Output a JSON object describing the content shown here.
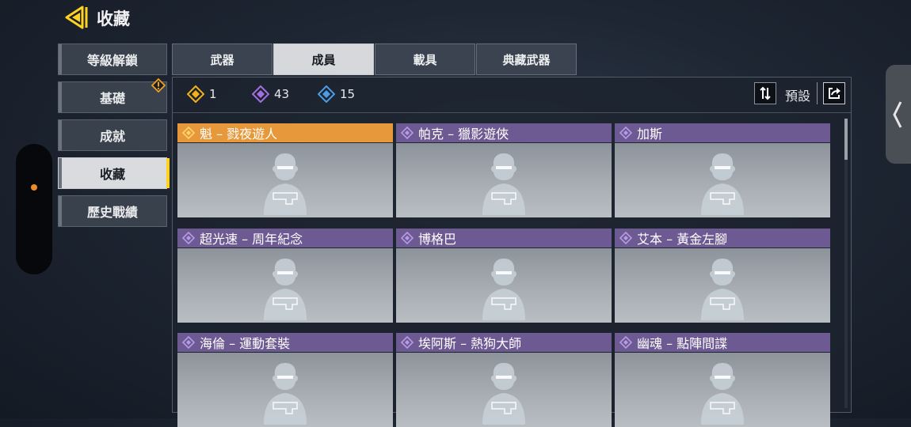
{
  "header": {
    "title": "收藏",
    "back_icon": "back-arrow-icon"
  },
  "sidebar": {
    "items": [
      {
        "label": "等級解鎖",
        "selected": false
      },
      {
        "label": "基礎",
        "selected": false,
        "alert": true
      },
      {
        "label": "成就",
        "selected": false
      },
      {
        "label": "收藏",
        "selected": true
      },
      {
        "label": "歷史戰績",
        "selected": false
      }
    ]
  },
  "tabs": [
    {
      "label": "武器",
      "selected": false
    },
    {
      "label": "成員",
      "selected": true
    },
    {
      "label": "載具",
      "selected": false
    },
    {
      "label": "典藏武器",
      "selected": false
    }
  ],
  "stats": [
    {
      "rarity": "legendary",
      "count": "1",
      "color": "#f2b11c"
    },
    {
      "rarity": "epic",
      "count": "43",
      "color": "#a36ee0"
    },
    {
      "rarity": "rare",
      "count": "15",
      "color": "#4d9ce6"
    }
  ],
  "toolbar": {
    "sort_label": "預設",
    "sort_icon": "sort-arrows-icon",
    "share_icon": "share-icon"
  },
  "cards": [
    {
      "name": "魁 – 戮夜遊人",
      "rarity": "legendary"
    },
    {
      "name": "帕克 – 獵影遊俠",
      "rarity": "epic"
    },
    {
      "name": "加斯",
      "rarity": "epic"
    },
    {
      "name": "超光速 – 周年紀念",
      "rarity": "epic"
    },
    {
      "name": "博格巴",
      "rarity": "epic"
    },
    {
      "name": "艾本 – 黃金左腳",
      "rarity": "epic"
    },
    {
      "name": "海倫 – 運動套裝",
      "rarity": "epic"
    },
    {
      "name": "埃阿斯 – 熱狗大師",
      "rarity": "epic"
    },
    {
      "name": "幽魂 – 點陣間諜",
      "rarity": "epic"
    }
  ],
  "colors": {
    "legendary_header": "#e6983a",
    "epic_header": "#6e5a93",
    "accent": "#ffd21f"
  }
}
